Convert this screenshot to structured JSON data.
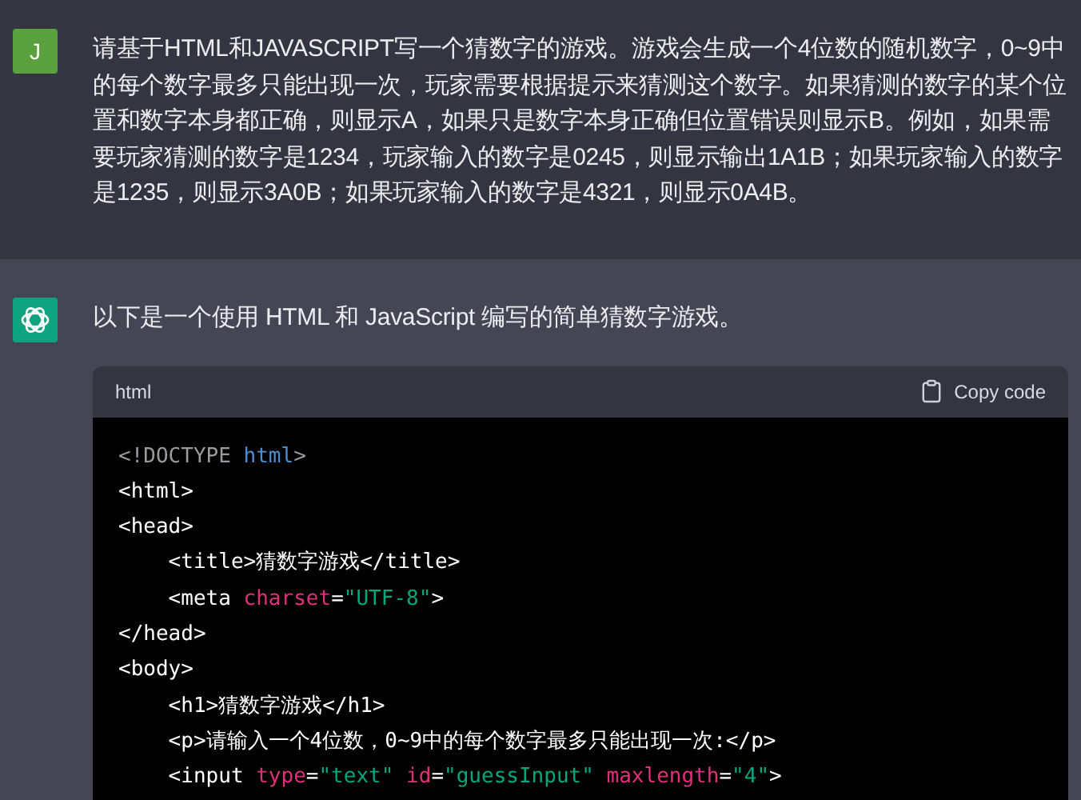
{
  "messages": [
    {
      "kind": "user",
      "avatar": "J",
      "text": "请基于HTML和JAVASCRIPT写一个猜数字的游戏。游戏会生成一个4位数的随机数字，0~9中的每个数字最多只能出现一次，玩家需要根据提示来猜测这个数字。如果猜测的数字的某个位置和数字本身都正确，则显示A，如果只是数字本身正确但位置错误则显示B。例如，如果需要玩家猜测的数字是1234，玩家输入的数字是0245，则显示输出1A1B；如果玩家输入的数字是1235，则显示3A0B；如果玩家输入的数字是4321，则显示0A4B。"
    },
    {
      "kind": "assistant",
      "text": "以下是一个使用 HTML 和 JavaScript 编写的简单猜数字游戏。",
      "code": {
        "language": "html",
        "copy_label": "Copy code",
        "lines": [
          [
            {
              "text": "<!DOCTYPE ",
              "kind": "meta"
            },
            {
              "text": "html",
              "kind": "keyword"
            },
            {
              "text": ">",
              "kind": "meta"
            }
          ],
          [
            {
              "text": "<html>",
              "kind": "plain"
            }
          ],
          [
            {
              "text": "<head>",
              "kind": "plain"
            }
          ],
          [
            {
              "text": "    <title>猜数字游戏</title>",
              "kind": "plain"
            }
          ],
          [
            {
              "text": "    <meta ",
              "kind": "plain"
            },
            {
              "text": "charset",
              "kind": "attr"
            },
            {
              "text": "=",
              "kind": "plain"
            },
            {
              "text": "\"UTF-8\"",
              "kind": "string"
            },
            {
              "text": ">",
              "kind": "plain"
            }
          ],
          [
            {
              "text": "</head>",
              "kind": "plain"
            }
          ],
          [
            {
              "text": "<body>",
              "kind": "plain"
            }
          ],
          [
            {
              "text": "    <h1>猜数字游戏</h1>",
              "kind": "plain"
            }
          ],
          [
            {
              "text": "    <p>请输入一个4位数，0~9中的每个数字最多只能出现一次:</p>",
              "kind": "plain"
            }
          ],
          [
            {
              "text": "    <input ",
              "kind": "plain"
            },
            {
              "text": "type",
              "kind": "attr"
            },
            {
              "text": "=",
              "kind": "plain"
            },
            {
              "text": "\"text\" ",
              "kind": "string"
            },
            {
              "text": "id",
              "kind": "attr"
            },
            {
              "text": "=",
              "kind": "plain"
            },
            {
              "text": "\"guessInput\" ",
              "kind": "string"
            },
            {
              "text": "maxlength",
              "kind": "attr"
            },
            {
              "text": "=",
              "kind": "plain"
            },
            {
              "text": "\"4\"",
              "kind": "string"
            },
            {
              "text": ">",
              "kind": "plain"
            }
          ]
        ]
      }
    }
  ]
}
